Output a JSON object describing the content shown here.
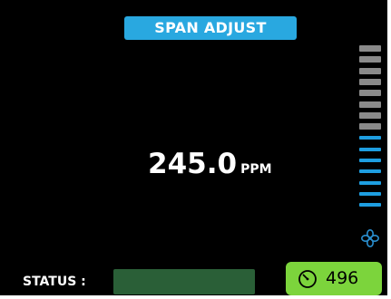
{
  "header": {
    "title": "SPAN ADJUST"
  },
  "reading": {
    "value": "245.0",
    "unit": "PPM"
  },
  "level_meter": {
    "segments_total": 15,
    "segments_active": 7,
    "level_fraction": 0.47,
    "active_color": "#1e9ee0",
    "inactive_color": "#8a8a8a"
  },
  "fan": {
    "icon": "fan-icon",
    "color": "#2a8fd0"
  },
  "status": {
    "label": "STATUS :",
    "indicator_color": "#2a5f37"
  },
  "counter": {
    "icon": "timer-icon",
    "value": "496",
    "color": "#7cd43c"
  }
}
